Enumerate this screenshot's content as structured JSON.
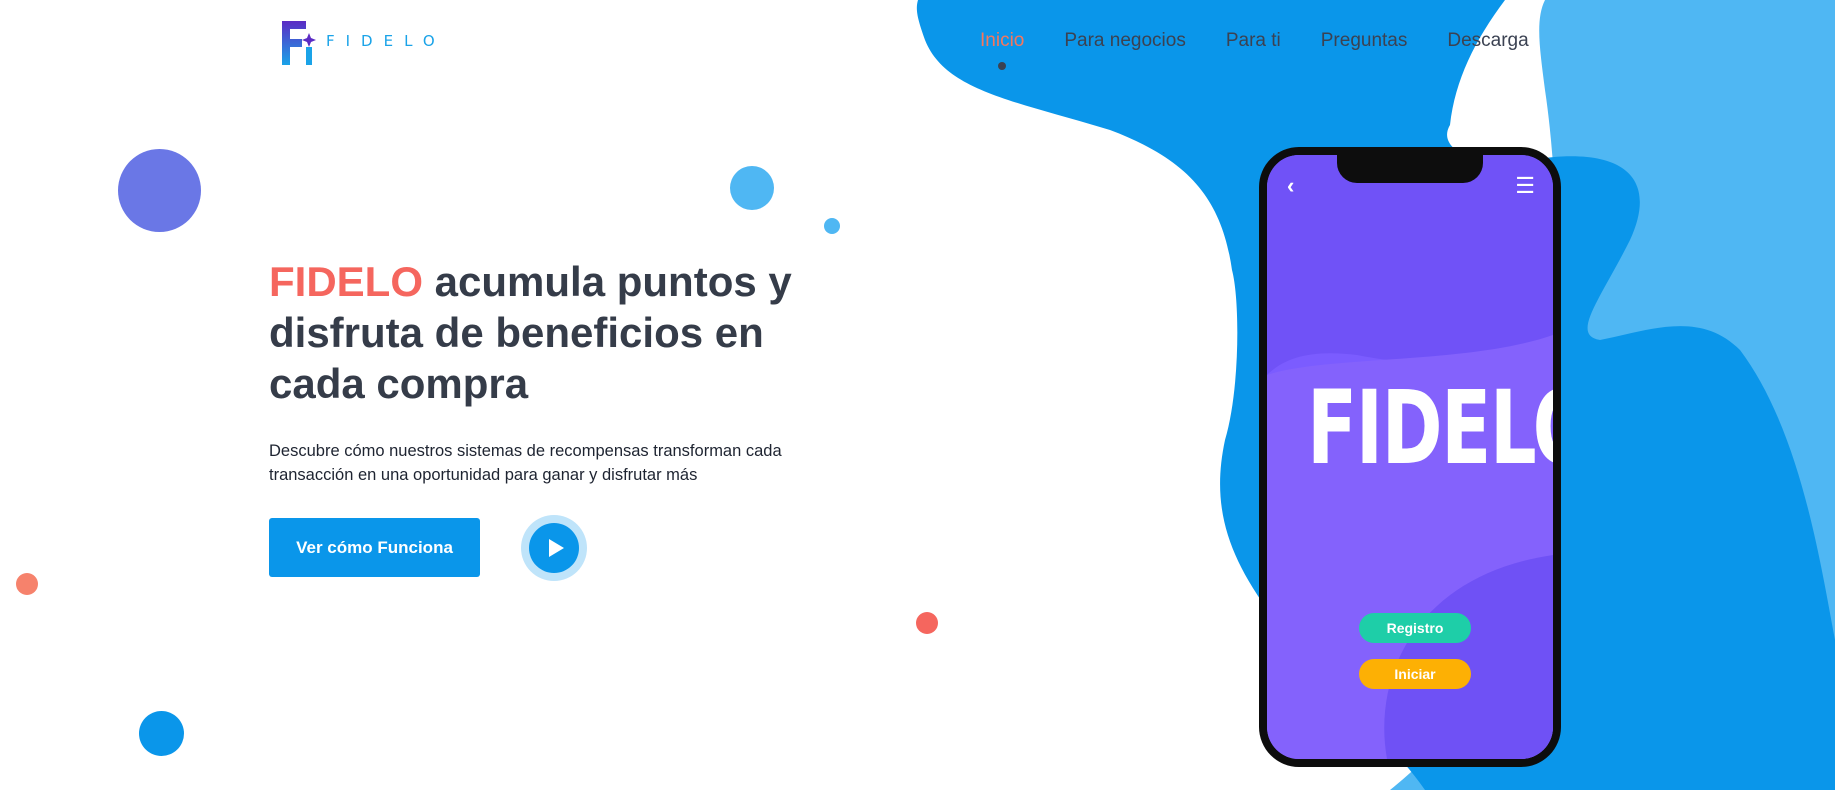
{
  "brand": {
    "logo_letter": "Fi",
    "logo_text": "FIDELO",
    "name": "FIDELO"
  },
  "nav": {
    "items": [
      {
        "label": "Inicio",
        "active": true
      },
      {
        "label": "Para negocios",
        "active": false
      },
      {
        "label": "Para ti",
        "active": false
      },
      {
        "label": "Preguntas",
        "active": false
      },
      {
        "label": "Descarga",
        "active": false
      }
    ]
  },
  "hero": {
    "title_brand": "FIDELO",
    "title_rest": "acumula puntos y disfruta de beneficios en cada compra",
    "description": "Descubre cómo nuestros sistemas de recompensas transforman cada transacción en una oportunidad para ganar y disfrutar más",
    "cta_label": "Ver cómo Funciona",
    "play_icon": "play-icon"
  },
  "phone": {
    "back_icon": "chevron-left-icon",
    "menu_icon": "hamburger-menu-icon",
    "logo_text": "FIDELO",
    "register_label": "Registro",
    "login_label": "Iniciar"
  },
  "colors": {
    "accent_blue": "#0a96ea",
    "light_blue": "#4fb7f3",
    "brand_red": "#f5665e",
    "phone_purple": "#7b5cff",
    "register_green": "#1ecea8",
    "login_yellow": "#fdb004",
    "title_dark": "#353c49"
  }
}
